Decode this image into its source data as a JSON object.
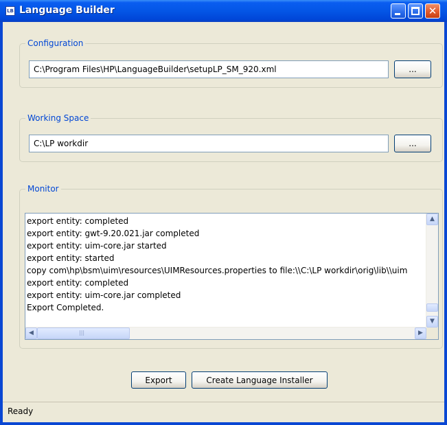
{
  "window": {
    "title": "Language Builder",
    "icon_text": "LB"
  },
  "configuration": {
    "group_title": "Configuration",
    "path_value": "C:\\Program Files\\HP\\LanguageBuilder\\setupLP_SM_920.xml",
    "browse_label": "..."
  },
  "working_space": {
    "group_title": "Working Space",
    "path_value": "C:\\LP workdir",
    "browse_label": "..."
  },
  "monitor": {
    "group_title": "Monitor",
    "lines": [
      "export entity:  completed",
      "export entity: gwt-9.20.021.jar completed",
      "export entity: uim-core.jar started",
      "export entity:  started",
      "copy com\\hp\\bsm\\uim\\resources\\UIMResources.properties to file:\\\\C:\\LP workdir\\orig\\lib\\\\uim",
      "export entity:  completed",
      "export entity: uim-core.jar completed",
      "Export  Completed."
    ]
  },
  "actions": {
    "export_label": "Export",
    "create_installer_label": "Create Language Installer"
  },
  "status": {
    "text": "Ready"
  },
  "icons": {
    "minimize": "minimize-icon",
    "maximize": "maximize-icon",
    "close": "close-icon",
    "scroll_up": "arrow-up-icon",
    "scroll_down": "arrow-down-icon",
    "scroll_left": "arrow-left-icon",
    "scroll_right": "arrow-right-icon"
  },
  "colors": {
    "titlebar": "#0456e6",
    "window_bg": "#ece9d8",
    "group_title": "#0046d5",
    "close_button": "#e35a2b"
  }
}
